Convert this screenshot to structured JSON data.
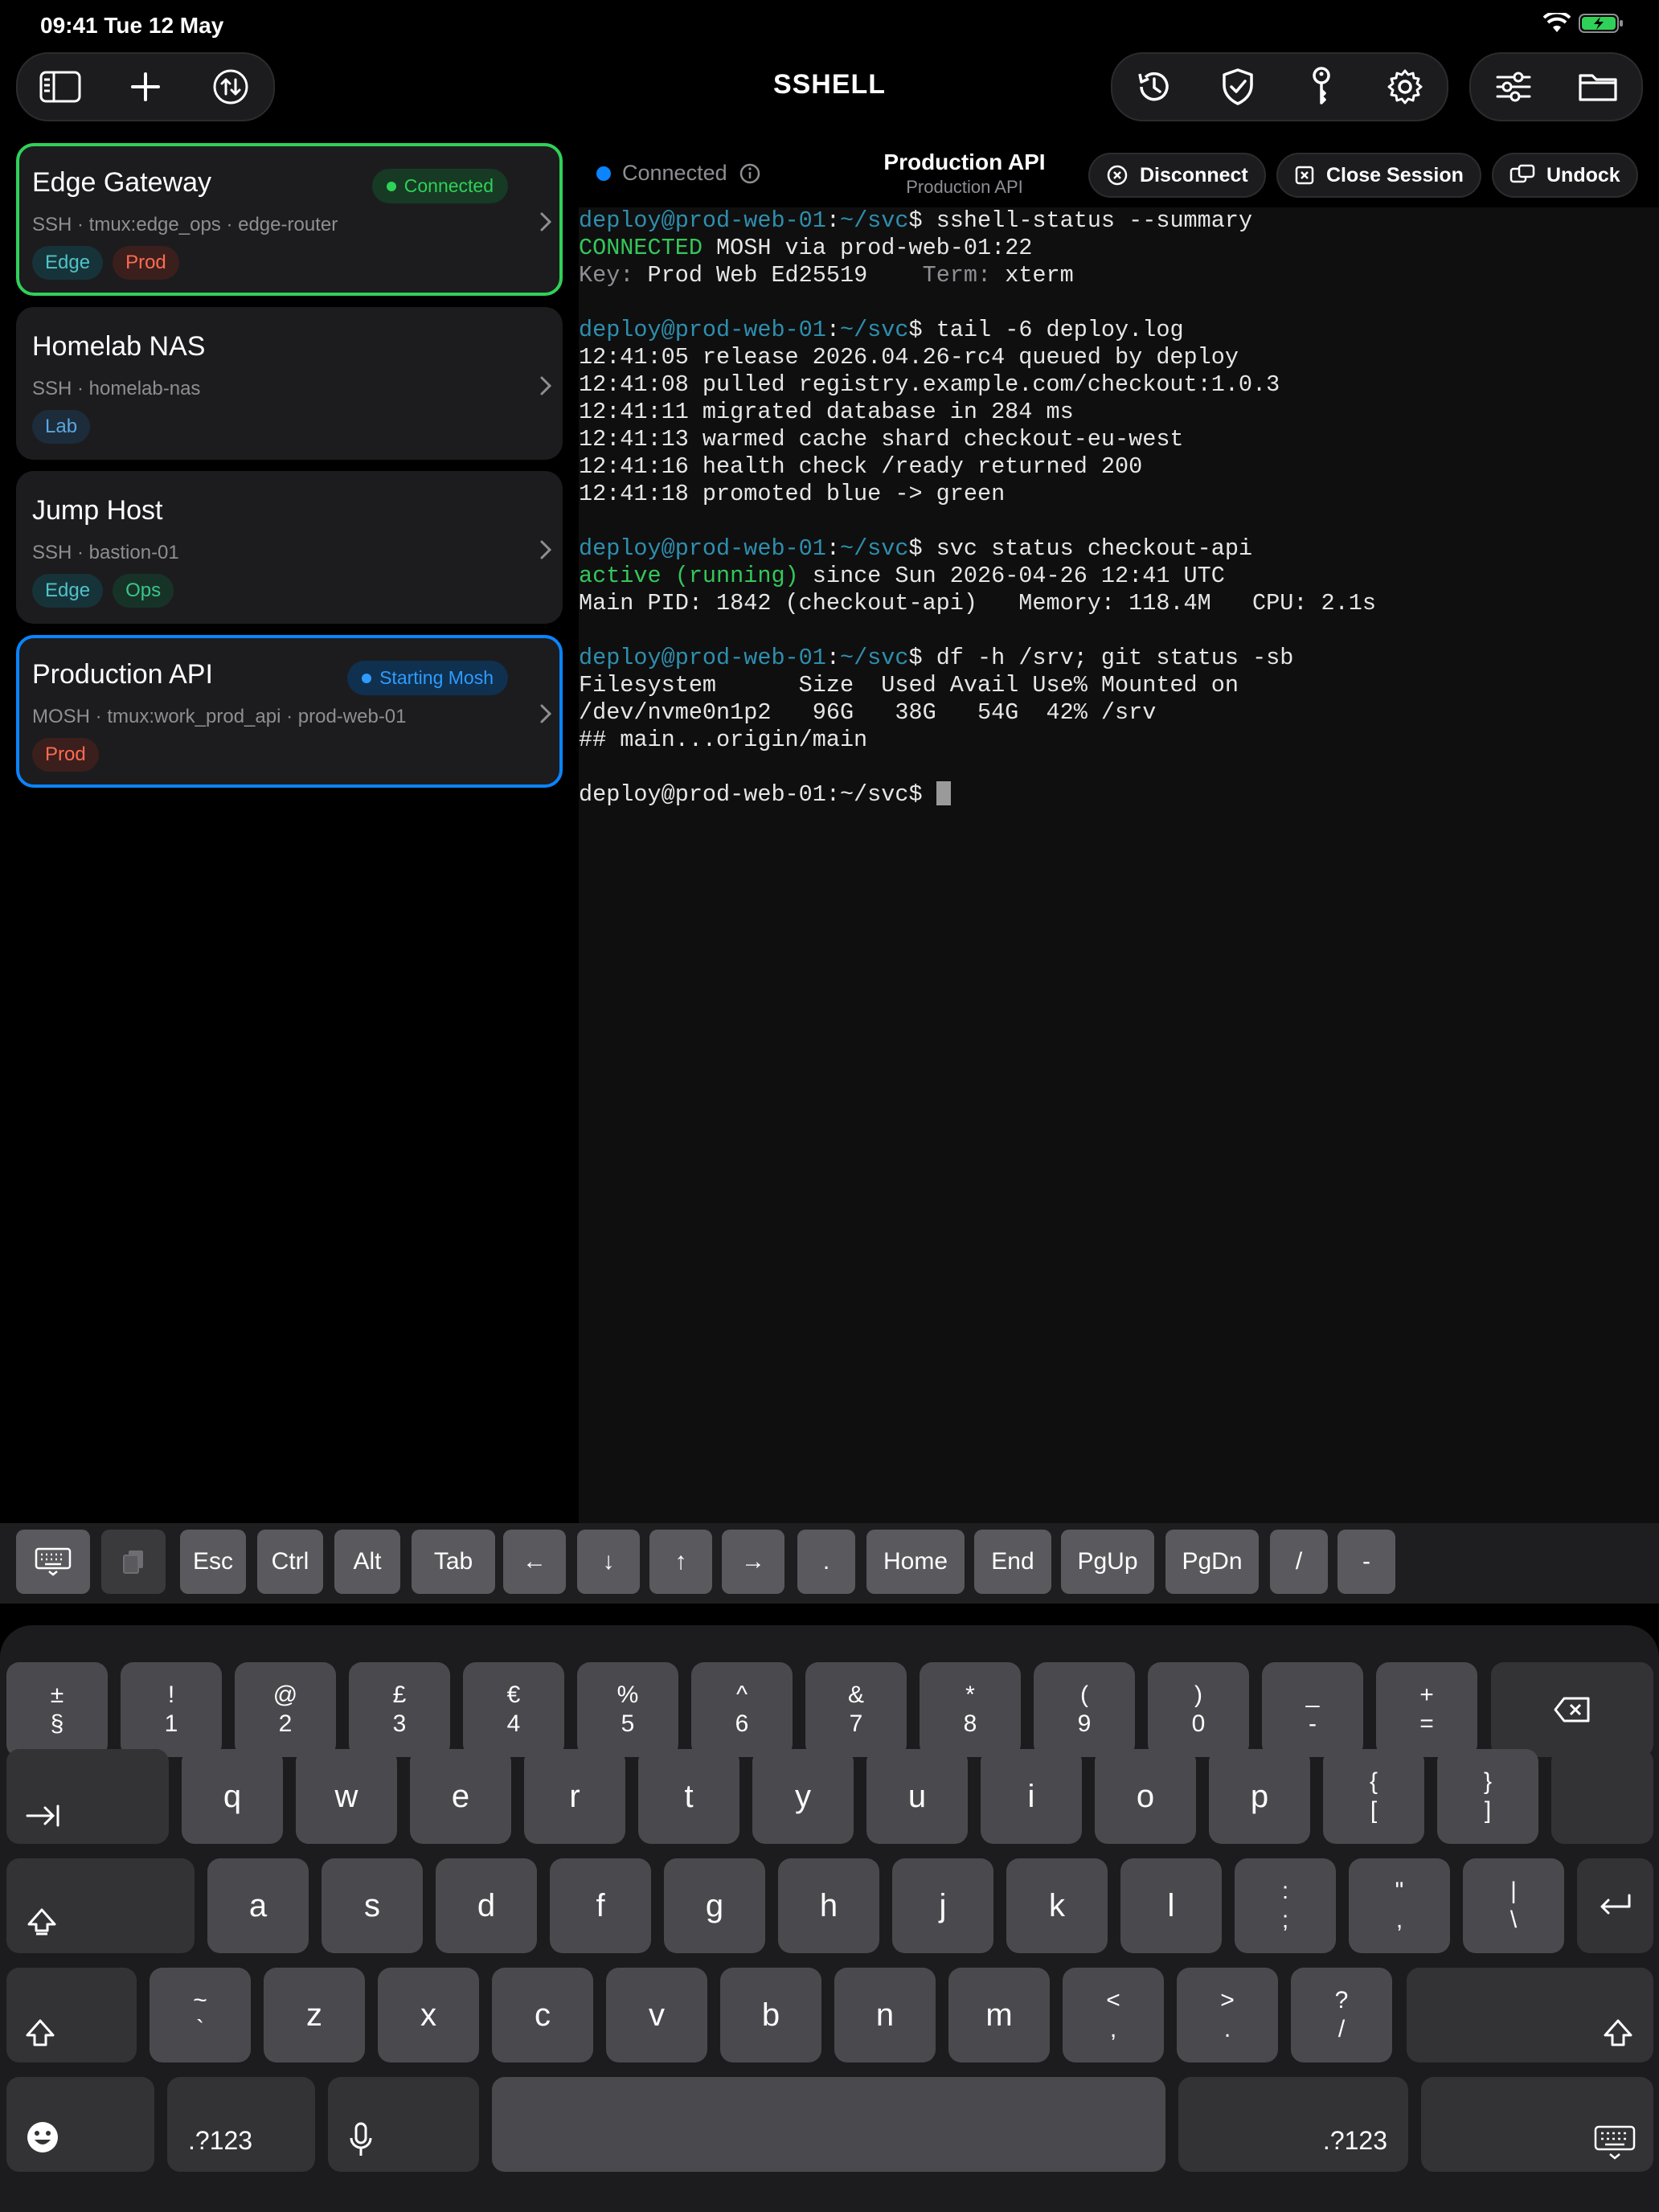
{
  "status_bar": {
    "time_date": "09:41  Tue 12 May"
  },
  "app": {
    "title": "SSHELL"
  },
  "sidebar": {
    "sessions": [
      {
        "title": "Edge Gateway",
        "subtitle": "SSH · tmux:edge_ops · edge-router",
        "badge": "Connected",
        "tags": [
          "Edge",
          "Prod"
        ]
      },
      {
        "title": "Homelab NAS",
        "subtitle": "SSH · homelab-nas",
        "tags": [
          "Lab"
        ]
      },
      {
        "title": "Jump Host",
        "subtitle": "SSH · bastion-01",
        "tags": [
          "Edge",
          "Ops"
        ]
      },
      {
        "title": "Production API",
        "subtitle": "MOSH · tmux:work_prod_api · prod-web-01",
        "badge": "Starting Mosh",
        "tags": [
          "Prod"
        ]
      }
    ]
  },
  "session_header": {
    "status": "Connected",
    "title": "Production API",
    "subtitle": "Production API",
    "disconnect": "Disconnect",
    "close_session": "Close Session",
    "undock": "Undock"
  },
  "terminal": {
    "prompt_user": "deploy@prod-web-01",
    "prompt_path": "~/svc",
    "cmd1": "sshell-status --summary",
    "out1_status": "CONNECTED",
    "out1_rest": " MOSH via prod-web-01:22",
    "out1_key_label": "Key:",
    "out1_key_value": " Prod Web Ed25519    ",
    "out1_term_label": "Term:",
    "out1_term_value": " xterm",
    "cmd2": "tail -6 deploy.log",
    "log": [
      "12:41:05 release 2026.04.26-rc4 queued by deploy",
      "12:41:08 pulled registry.example.com/checkout:1.0.3",
      "12:41:11 migrated database in 284 ms",
      "12:41:13 warmed cache shard checkout-eu-west",
      "12:41:16 health check /ready returned 200",
      "12:41:18 promoted blue -> green"
    ],
    "cmd3": "svc status checkout-api",
    "out3_active": "active (running)",
    "out3_since": " since Sun 2026-04-26 12:41 UTC",
    "out3_pid": "Main PID: 1842 (checkout-api)   Memory: 118.4M   CPU: 2.1s",
    "cmd4": "df -h /srv; git status -sb",
    "out4": [
      "Filesystem      Size  Used Avail Use% Mounted on",
      "/dev/nvme0n1p2   96G   38G   54G  42% /srv",
      "## main...origin/main"
    ],
    "final_prompt": "deploy@prod-web-01:~/svc$ "
  },
  "accessory_keys": [
    "Esc",
    "Ctrl",
    "Alt",
    "Tab",
    "←",
    "↓",
    "↑",
    "→",
    ".",
    "Home",
    "End",
    "PgUp",
    "PgDn",
    "/",
    "-"
  ],
  "keyboard": {
    "row1": [
      [
        "±",
        "§"
      ],
      [
        "!",
        "1"
      ],
      [
        "@",
        "2"
      ],
      [
        "£",
        "3"
      ],
      [
        "€",
        "4"
      ],
      [
        "%",
        "5"
      ],
      [
        "^",
        "6"
      ],
      [
        "&",
        "7"
      ],
      [
        "*",
        "8"
      ],
      [
        "(",
        "9"
      ],
      [
        ")",
        "0"
      ],
      [
        "_",
        "-"
      ],
      [
        "+",
        "="
      ]
    ],
    "row2": [
      "q",
      "w",
      "e",
      "r",
      "t",
      "y",
      "u",
      "i",
      "o",
      "p"
    ],
    "row2_extra": [
      [
        "{",
        "["
      ],
      [
        "}",
        "]"
      ]
    ],
    "row3": [
      "a",
      "s",
      "d",
      "f",
      "g",
      "h",
      "j",
      "k",
      "l"
    ],
    "row3_extra": [
      [
        ":",
        ";"
      ],
      [
        "\"",
        ","
      ],
      [
        "|",
        "\\"
      ]
    ],
    "row4_first": [
      "~",
      "`"
    ],
    "row4": [
      "z",
      "x",
      "c",
      "v",
      "b",
      "n",
      "m"
    ],
    "row4_extra": [
      [
        "<",
        ","
      ],
      [
        ">",
        "."
      ],
      [
        "?",
        "/"
      ]
    ],
    "numbers_label": ".?123"
  },
  "colors": {
    "accent_blue": "#0a84ff",
    "connected_green": "#30d158",
    "prod_red": "#ff6b52"
  }
}
